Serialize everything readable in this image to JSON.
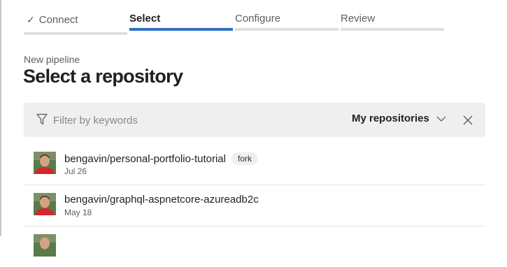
{
  "stepper": {
    "steps": [
      {
        "label": "Connect",
        "state": "completed",
        "icon": "checkmark-icon"
      },
      {
        "label": "Select",
        "state": "active"
      },
      {
        "label": "Configure",
        "state": "pending"
      },
      {
        "label": "Review",
        "state": "pending"
      }
    ]
  },
  "header": {
    "subtitle": "New pipeline",
    "title": "Select a repository"
  },
  "filter": {
    "placeholder": "Filter by keywords",
    "value": "",
    "scope_label": "My repositories",
    "icons": {
      "filter": "filter-icon",
      "dropdown": "chevron-down-icon",
      "close": "close-icon"
    }
  },
  "repositories": [
    {
      "name": "bengavin/personal-portfolio-tutorial",
      "badge": "fork",
      "date": "Jul 26"
    },
    {
      "name": "bengavin/graphql-aspnetcore-azureadb2c",
      "badge": "",
      "date": "May 18"
    }
  ],
  "colors": {
    "accent": "#2f6fc4",
    "filter_bg": "#efefef"
  }
}
